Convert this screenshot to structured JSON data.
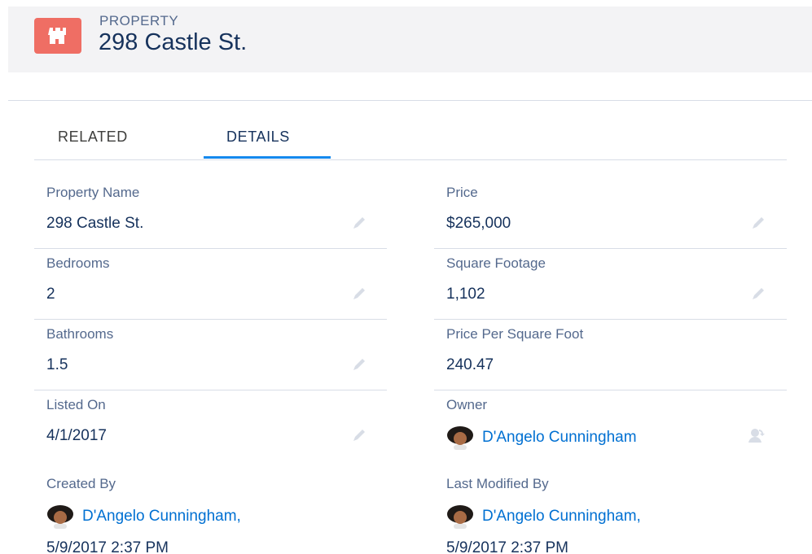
{
  "header": {
    "object_label": "PROPERTY",
    "record_title": "298 Castle St.",
    "icon": "castle-icon",
    "icon_color": "#ef6e64"
  },
  "tabs": [
    {
      "label": "RELATED",
      "active": false
    },
    {
      "label": "DETAILS",
      "active": true
    }
  ],
  "accent_color": "#1589ee",
  "fields": {
    "property_name": {
      "label": "Property Name",
      "value": "298 Castle St."
    },
    "price": {
      "label": "Price",
      "value": "$265,000"
    },
    "bedrooms": {
      "label": "Bedrooms",
      "value": "2"
    },
    "square_footage": {
      "label": "Square Footage",
      "value": "1,102"
    },
    "bathrooms": {
      "label": "Bathrooms",
      "value": "1.5"
    },
    "price_per_sqft": {
      "label": "Price Per Square Foot",
      "value": "240.47"
    },
    "listed_on": {
      "label": "Listed On",
      "value": "4/1/2017"
    },
    "owner": {
      "label": "Owner",
      "value": "D'Angelo Cunningham"
    },
    "created_by": {
      "label": "Created By",
      "user": "D'Angelo Cunningham,",
      "date": "5/9/2017 2:37 PM"
    },
    "last_modified_by": {
      "label": "Last Modified By",
      "user": "D'Angelo Cunningham,",
      "date": "5/9/2017 2:37 PM"
    }
  }
}
